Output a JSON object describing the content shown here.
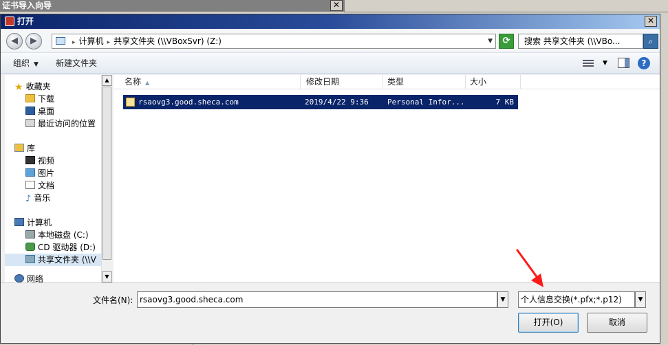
{
  "background_window": {
    "title": "证书导入向导",
    "close_glyph": "✕"
  },
  "dialog": {
    "title": "打开",
    "close_glyph": "✕"
  },
  "address_bar": {
    "crumbs": [
      "计算机",
      "共享文件夹 (\\\\VBoxSvr) (Z:)"
    ],
    "separator": "▸",
    "dropdown_glyph": "▼"
  },
  "search": {
    "placeholder": "搜索 共享文件夹 (\\\\VBo..."
  },
  "toolbar": {
    "organize_label": "组织",
    "organize_caret": "▼",
    "new_folder_label": "新建文件夹",
    "views_caret": "▼",
    "help_glyph": "?"
  },
  "nav_pane": {
    "items": [
      {
        "label": "收藏夹",
        "icon": "star-icon"
      },
      {
        "label": "下载",
        "icon": "download-folder-icon"
      },
      {
        "label": "桌面",
        "icon": "desktop-icon"
      },
      {
        "label": "最近访问的位置",
        "icon": "recent-places-icon"
      },
      {
        "label": "库",
        "icon": "library-icon"
      },
      {
        "label": "视频",
        "icon": "video-icon"
      },
      {
        "label": "图片",
        "icon": "pictures-icon"
      },
      {
        "label": "文档",
        "icon": "documents-icon"
      },
      {
        "label": "音乐",
        "icon": "music-icon"
      },
      {
        "label": "计算机",
        "icon": "computer-icon"
      },
      {
        "label": "本地磁盘 (C:)",
        "icon": "hard-disk-icon"
      },
      {
        "label": "CD 驱动器 (D:)",
        "icon": "cd-drive-icon"
      },
      {
        "label": "共享文件夹 (\\\\V",
        "icon": "shared-folder-icon"
      },
      {
        "label": "网络",
        "icon": "network-icon"
      }
    ],
    "selected_index": 12
  },
  "file_list": {
    "columns": [
      "名称",
      "修改日期",
      "类型",
      "大小"
    ],
    "sort_glyph": "▲",
    "rows": [
      {
        "name": "rsaovg3.good.sheca.com",
        "date": "2019/4/22 9:36",
        "type": "Personal Infor...",
        "size": "7 KB"
      }
    ]
  },
  "bottom": {
    "file_name_label": "文件名(N):",
    "file_name_value": "rsaovg3.good.sheca.com",
    "file_type_value": "个人信息交换(*.pfx;*.p12)",
    "dropdown_glyph": "▼",
    "open_button": "打开(O)",
    "cancel_button": "取消"
  },
  "colors": {
    "selection": "#0a246a",
    "title_bar": "#0a246a",
    "annotation_arrow": "#ff1a1a"
  }
}
